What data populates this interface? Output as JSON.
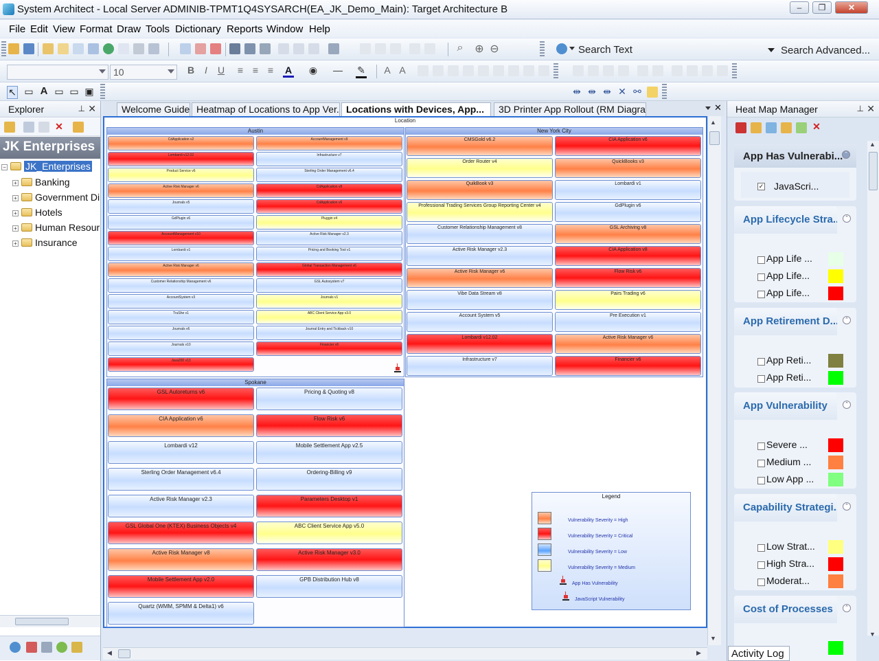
{
  "window": {
    "title": "System Architect - Local Server ADMINIB-TPMT1Q4SYSARCH(EA_JK_Demo_Main): Target Architecture B"
  },
  "menu": [
    "File",
    "Edit",
    "View",
    "Format",
    "Draw",
    "Tools",
    "Dictionary",
    "Reports",
    "Window",
    "Help"
  ],
  "toolbar": {
    "search_label": "Search Text",
    "search_advanced": "Search Advanced...",
    "font_size": "10",
    "font_name": ""
  },
  "explorer": {
    "title": "Explorer",
    "banner": "JK Enterprises",
    "root": "JK_Enterprises",
    "items": [
      "Banking",
      "Government Di",
      "Hotels",
      "Human Resour",
      "Insurance"
    ]
  },
  "tabs": [
    "Welcome Guide",
    "Heatmap of Locations to App Ver...",
    "Locations with Devices, App...",
    "3D Printer App Rollout (RM Diagra..."
  ],
  "diagram": {
    "title": "Location",
    "regions": [
      {
        "name": "Austin",
        "apps_left": [
          "CdApplication v2",
          "Lombardi v12.02",
          "Product Service v6",
          "Active Risk Manager v6",
          "Journals v5",
          "GdPlugin v6",
          "AccountManagement v10",
          "Lombardi v1",
          "Active Risk Manager v6",
          "Customer Relationship Management v6",
          "AccountSystem v3",
          "TruShe v1",
          "Journals v6",
          "Journals v10",
          "Java200 v13"
        ],
        "apps_right": [
          "AccountManagement v9",
          "Infrastructure v7",
          "Sterling Order Management v6.4",
          "CdApplication v8",
          "CdApplication v6",
          "Pluggin v4",
          "Active Risk Manager v2.3",
          "Pricing and Booking Tool v1",
          "Global Transaction Management v6",
          "GSL Autosystem v7",
          "Journals v1",
          "ABC Client Service App v3.0",
          "Journal Entry and Tickback v10",
          "Financier v6"
        ]
      },
      {
        "name": "New York City",
        "apps_left": [
          "CMSGold v6.2",
          "Order Router v4",
          "QuikBook v3",
          "Professional Trading Services Group Reporting Center v4",
          "Customer Relationship Management v8",
          "Active Risk Manager v2.3",
          "Active Risk Manager v6",
          "Vibe Data Stream v8",
          "Account System v5",
          "Lombardi v12.02",
          "Infrastructure v7"
        ],
        "apps_right": [
          "CIA Application v6",
          "QuickBooks v3",
          "Lombardi v1",
          "GdPlugin v6",
          "GSL Archiving v8",
          "CIA Application v8",
          "Flow Risk v6",
          "Pairs Trading v6",
          "Pre Execution v1",
          "Active Risk Manager v6",
          "Financier v6"
        ]
      },
      {
        "name": "Spokane",
        "apps_left": [
          "GSL Autoreturns v6",
          "CIA Application v6",
          "Lombardi v12",
          "Sterling Order Management v6.4",
          "Active Risk Manager v2.3",
          "GSL Global One (KTEX) Business Objects v4",
          "Active Risk Manager v8",
          "Mobile Settlement App v2.0",
          "Quartz (WMM, SPMM & Delta1) v6"
        ],
        "apps_right": [
          "Pricing & Quoting v8",
          "Flow Risk v6",
          "Mobile Settlement App v2.5",
          "Ordering-Billing v9",
          "Parameters Desktop v1",
          "ABC Client Service App v5.0",
          "Active Risk Manager v3.0",
          "GPB Distribution Hub v8"
        ]
      }
    ],
    "legend": {
      "title": "Legend",
      "items": [
        "Vulnerability Severity = High",
        "Vulnerability Severity = Critical",
        "Vulnerability Severity = Low",
        "Vulnerability Severity = Medium",
        "App Has Vulnerability",
        "JavaScript Vulnerability"
      ]
    }
  },
  "heatmap": {
    "title": "Heat Map Manager",
    "sections": [
      {
        "title": "App Has Vulnerabi...",
        "items": [
          {
            "label": "JavaScri...",
            "checked": true
          }
        ]
      },
      {
        "title": "App Lifecycle Stra...",
        "items": [
          {
            "label": "App Life ...",
            "color": "#e6ffe6"
          },
          {
            "label": "App Life...",
            "color": "#ffff00"
          },
          {
            "label": "App Life...",
            "color": "#ff0000"
          }
        ]
      },
      {
        "title": "App Retirement D...",
        "items": [
          {
            "label": "App Reti...",
            "color": "#808040"
          },
          {
            "label": "App Reti...",
            "color": "#00ff00"
          }
        ]
      },
      {
        "title": "App Vulnerability",
        "items": [
          {
            "label": "Severe ...",
            "color": "#ff0000"
          },
          {
            "label": "Medium ...",
            "color": "#ff8040"
          },
          {
            "label": "Low App ...",
            "color": "#80ff80"
          }
        ]
      },
      {
        "title": "Capability Strategi...",
        "items": [
          {
            "label": "Low Strat...",
            "color": "#ffff80"
          },
          {
            "label": "High Stra...",
            "color": "#ff0000"
          },
          {
            "label": "Moderat...",
            "color": "#ff8040"
          }
        ]
      },
      {
        "title": "Cost of Processes",
        "items": []
      }
    ]
  },
  "status": {
    "activity_log": "Activity Log"
  }
}
